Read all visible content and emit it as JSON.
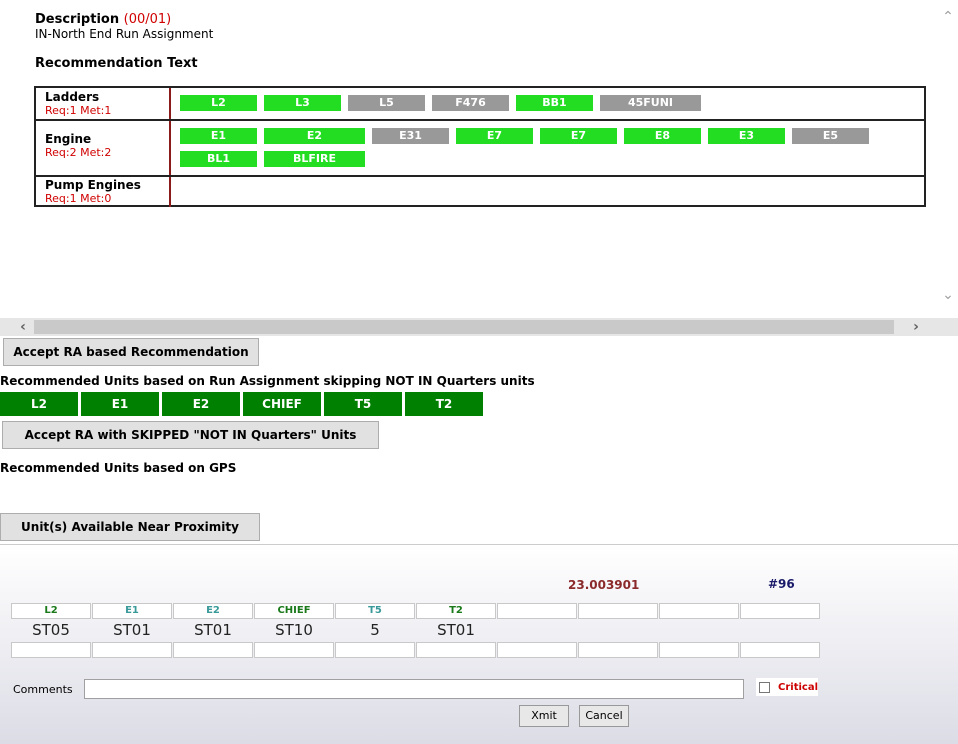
{
  "description": {
    "label": "Description",
    "count": "(00/01)",
    "value": "IN-North End Run Assignment"
  },
  "recommendation": {
    "title": "Recommendation Text",
    "rows": [
      {
        "name": "Ladders",
        "req": "Req:1  Met:1",
        "chips": [
          {
            "label": "L2",
            "status": "green"
          },
          {
            "label": "L3",
            "status": "green"
          },
          {
            "label": "L5",
            "status": "gray"
          },
          {
            "label": "F476",
            "status": "gray"
          },
          {
            "label": "BB1",
            "status": "green"
          },
          {
            "label": "45FUNI",
            "status": "gray"
          }
        ]
      },
      {
        "name": "Engine",
        "req": "Req:2  Met:2",
        "chips": [
          {
            "label": "E1",
            "status": "green"
          },
          {
            "label": "E2",
            "status": "green"
          },
          {
            "label": "E31",
            "status": "gray"
          },
          {
            "label": "E7",
            "status": "green"
          },
          {
            "label": "E7",
            "status": "green"
          },
          {
            "label": "E8",
            "status": "green"
          },
          {
            "label": "E3",
            "status": "green"
          },
          {
            "label": "E5",
            "status": "gray"
          },
          {
            "label": "BL1",
            "status": "green"
          },
          {
            "label": "BLFIRE",
            "status": "green"
          }
        ]
      },
      {
        "name": "Pump Engines",
        "req": "Req:1  Met:0",
        "chips": []
      }
    ]
  },
  "actions": {
    "accept_ra": "Accept RA based Recommendation",
    "recommended_heading": "Recommended Units based on Run Assignment skipping NOT IN Quarters units",
    "recommended_units": [
      "L2",
      "E1",
      "E2",
      "CHIEF",
      "T5",
      "T2"
    ],
    "accept_skipped": "Accept RA with SKIPPED \"NOT IN Quarters\" Units",
    "gps_heading": "Recommended Units based on GPS",
    "near_proximity": "Unit(s) Available Near Proximity"
  },
  "dispatch": {
    "distance": "23.003901",
    "incident_no": "#96",
    "units": [
      {
        "unit": "L2",
        "station": "ST05",
        "color": "#1a7a1a"
      },
      {
        "unit": "E1",
        "station": "ST01",
        "color": "#3a9a9a"
      },
      {
        "unit": "E2",
        "station": "ST01",
        "color": "#3a9a9a"
      },
      {
        "unit": "CHIEF",
        "station": "ST10",
        "color": "#1a7a1a"
      },
      {
        "unit": "T5",
        "station": "5",
        "color": "#3a9a9a"
      },
      {
        "unit": "T2",
        "station": "ST01",
        "color": "#1a7a1a"
      }
    ],
    "comments_label": "Comments",
    "comments_value": "",
    "critical_label": "Critical",
    "xmit": "Xmit",
    "cancel": "Cancel"
  }
}
